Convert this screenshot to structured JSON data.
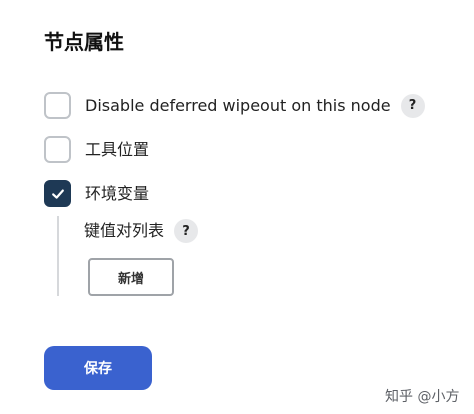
{
  "section": {
    "title": "节点属性"
  },
  "options": [
    {
      "label": "Disable deferred wipeout on this node",
      "checked": false,
      "has_help": true
    },
    {
      "label": "工具位置",
      "checked": false,
      "has_help": false
    },
    {
      "label": "环境变量",
      "checked": true,
      "has_help": false
    }
  ],
  "env_vars": {
    "key_value_label": "键值对列表",
    "add_label": "新增"
  },
  "help_glyph": "?",
  "save_label": "保存",
  "watermark": "知乎 @小方",
  "colors": {
    "checked_bg": "#1e3955",
    "primary_button": "#3a62cf",
    "help_bg": "#e7e8ea"
  },
  "icons": {
    "checkbox_checked": "check-icon",
    "help": "question-icon"
  }
}
